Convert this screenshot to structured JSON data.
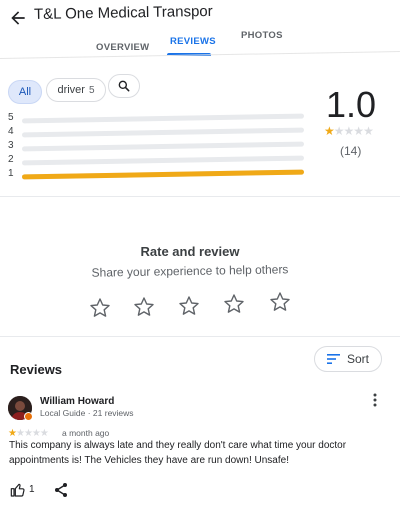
{
  "header": {
    "title": "T&L One Medical Transpor"
  },
  "tabs": [
    {
      "label": "OVERVIEW"
    },
    {
      "label": "REVIEWS"
    },
    {
      "label": "PHOTOS"
    }
  ],
  "filters": {
    "all_label": "All",
    "driver_label": "driver",
    "driver_count": "5"
  },
  "histogram": {
    "rows": [
      {
        "label": "5",
        "fraction": 0.0
      },
      {
        "label": "4",
        "fraction": 0.0
      },
      {
        "label": "3",
        "fraction": 0.0
      },
      {
        "label": "2",
        "fraction": 0.0
      },
      {
        "label": "1",
        "fraction": 1.0
      }
    ]
  },
  "summary": {
    "score": "1.0",
    "stars": 1,
    "count": "(14)"
  },
  "rate": {
    "title": "Rate and review",
    "subtitle": "Share your experience to help others"
  },
  "reviews": {
    "heading": "Reviews",
    "sort_label": "Sort",
    "items": [
      {
        "name": "William Howard",
        "meta": "Local Guide · 21 reviews",
        "stars": 1,
        "time": "a month ago",
        "text": "This company is always late and they really don't care what time your doctor appointments is! The Vehicles they have are run down! Unsafe!",
        "likes": "1"
      }
    ]
  },
  "colors": {
    "accent": "#1a73e8",
    "star": "#f0a917"
  }
}
